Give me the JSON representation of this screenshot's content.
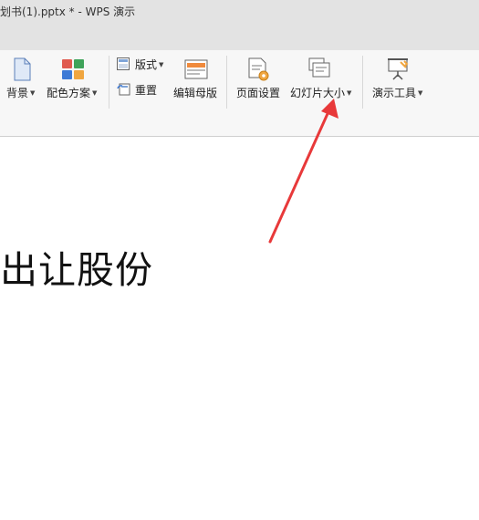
{
  "window": {
    "title": "划书(1).pptx * - WPS 演示"
  },
  "toolbar": {
    "background_label": "背景",
    "color_scheme_label": "配色方案",
    "layout_label": "版式",
    "reset_label": "重置",
    "edit_master_label": "编辑母版",
    "page_setup_label": "页面设置",
    "slide_size_label": "幻灯片大小",
    "presentation_tools_label": "演示工具"
  },
  "slide": {
    "text": "出让股份"
  },
  "colors": {
    "annotation_arrow": "#e8393a",
    "ribbon_bg": "#f7f7f7",
    "titlebar_bg": "#e3e3e3"
  }
}
